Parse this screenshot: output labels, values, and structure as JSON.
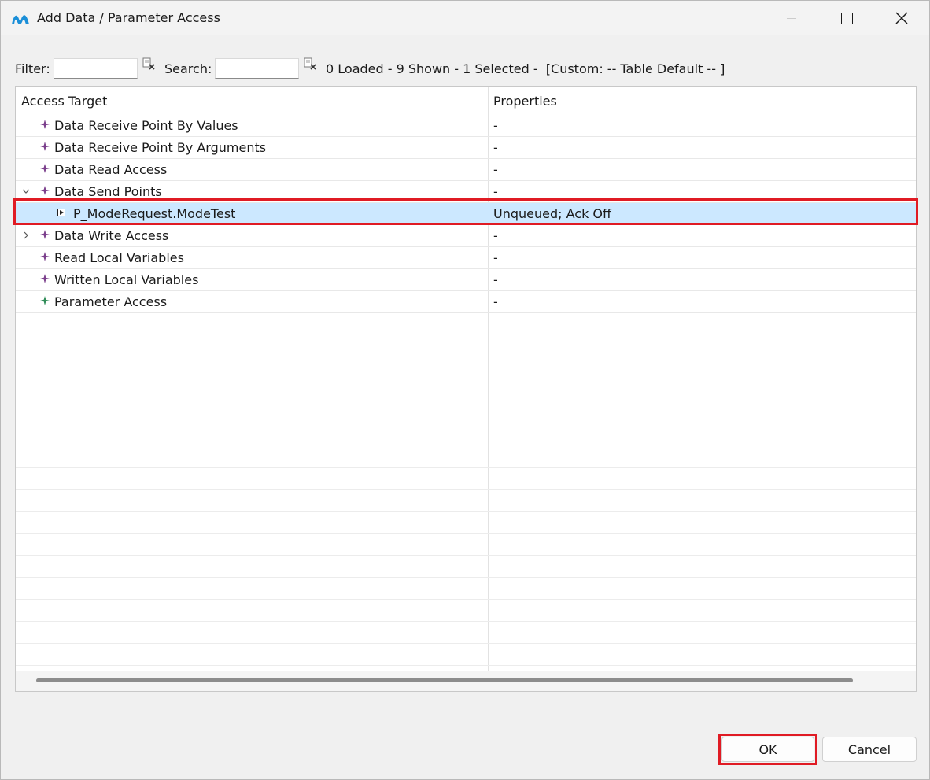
{
  "window": {
    "title": "Add Data / Parameter Access",
    "app_icon": "app-logo-icon",
    "controls": {
      "minimize": "minimize-icon",
      "maximize": "maximize-icon",
      "close": "close-icon"
    }
  },
  "toolbar": {
    "filter_label": "Filter:",
    "filter_value": "",
    "search_label": "Search:",
    "search_value": "",
    "clear_icon": "clear-filter-icon",
    "status": "0 Loaded - 9 Shown - 1 Selected -  [Custom: -- Table Default -- ]"
  },
  "table": {
    "columns": [
      "Access Target",
      "Properties"
    ],
    "rows": [
      {
        "label": "Data Receive Point By Values",
        "properties": "-",
        "icon": "purple-star-icon",
        "expander": "none"
      },
      {
        "label": "Data Receive Point By Arguments",
        "properties": "-",
        "icon": "purple-star-icon",
        "expander": "none"
      },
      {
        "label": "Data Read Access",
        "properties": "-",
        "icon": "purple-star-icon",
        "expander": "none"
      },
      {
        "label": "Data Send Points",
        "properties": "-",
        "icon": "purple-star-icon",
        "expander": "expanded"
      },
      {
        "label": "P_ModeRequest.ModeTest",
        "properties": "Unqueued; Ack Off",
        "icon": "port-icon",
        "expander": "none",
        "selected": true
      },
      {
        "label": "Data Write Access",
        "properties": "-",
        "icon": "purple-star-icon",
        "expander": "collapsed"
      },
      {
        "label": "Read Local Variables",
        "properties": "-",
        "icon": "purple-star-icon",
        "expander": "none"
      },
      {
        "label": "Written Local Variables",
        "properties": "-",
        "icon": "purple-star-icon",
        "expander": "none"
      },
      {
        "label": "Parameter Access",
        "properties": "-",
        "icon": "green-star-icon",
        "expander": "none"
      }
    ]
  },
  "buttons": {
    "ok": "OK",
    "cancel": "Cancel"
  },
  "colors": {
    "selection": "#cce8ff",
    "highlight_outline": "#e01b24",
    "purple_icon": "#7b3f8c",
    "green_icon": "#2e8b57",
    "logo_blue": "#1b8fd8"
  }
}
